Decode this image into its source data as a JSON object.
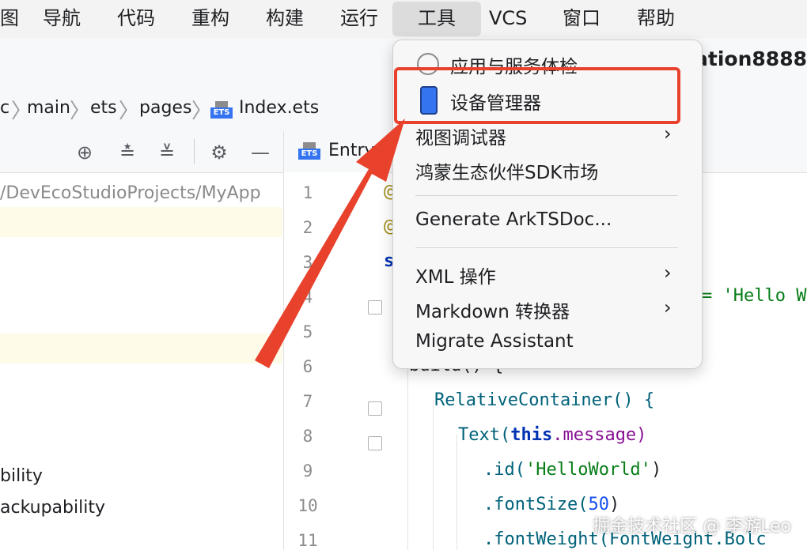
{
  "menubar": {
    "items": [
      "图",
      "导航",
      "代码",
      "重构",
      "构建",
      "运行",
      "工具",
      "VCS",
      "窗口",
      "帮助"
    ],
    "active": "工具"
  },
  "window_title": "ation8888",
  "breadcrumb": [
    "c",
    "main",
    "ets",
    "pages",
    "Index.ets"
  ],
  "ets_badge": "ETS",
  "left_pane": {
    "path": "/DevEcoStudioProjects/MyApp",
    "tree": [
      "bility",
      "ackupability"
    ]
  },
  "editor": {
    "tab_label": "Entry",
    "line_numbers": [
      "1",
      "2",
      "3",
      "4",
      "5",
      "6",
      "7",
      "8",
      "9",
      "10",
      "11"
    ],
    "code": {
      "l1": "@",
      "l2": "@",
      "l3": "s",
      "l4_partial": "= 'Hello W",
      "l6_partial": "build() {",
      "l7": "RelativeContainer() {",
      "l8_fn": "Text(",
      "l8_kw": "this",
      "l8_rest": ".message)",
      "l9_fn": ".id(",
      "l9_str": "'HelloWorld'",
      "l9_end": ")",
      "l10_fn": ".fontSize(",
      "l10_num": "50",
      "l10_end": ")",
      "l11": ".fontWeight(FontWeight.Bolc"
    }
  },
  "tools_menu": {
    "items": [
      {
        "label": "应用与服务体检"
      },
      {
        "label": "设备管理器"
      },
      {
        "label": "视图调试器",
        "submenu": true
      },
      {
        "label": "鸿蒙生态伙伴SDK市场"
      },
      {
        "label": "Generate ArkTSDoc..."
      },
      {
        "label": "XML 操作",
        "submenu": true
      },
      {
        "label": "Markdown 转换器",
        "submenu": true
      },
      {
        "label": "Migrate Assistant"
      }
    ]
  },
  "watermark": "掘金技术社区 @ 李游Leo",
  "colors": {
    "highlight": "#e8412c",
    "accent": "#3574f0",
    "code_green": "#067d17",
    "code_kw": "#0033b3"
  }
}
